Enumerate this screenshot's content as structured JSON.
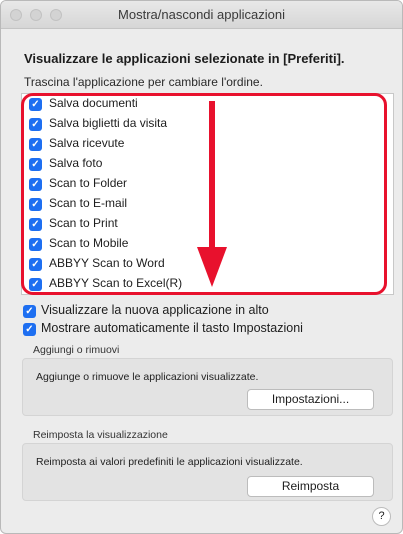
{
  "window": {
    "title": "Mostra/nascondi applicazioni"
  },
  "heading": "Visualizzare le applicazioni selezionate in [Preferiti].",
  "instruction": "Trascina l'applicazione per cambiare l'ordine.",
  "apps": [
    {
      "label": "Salva documenti",
      "checked": true
    },
    {
      "label": "Salva biglietti da visita",
      "checked": true
    },
    {
      "label": "Salva ricevute",
      "checked": true
    },
    {
      "label": "Salva foto",
      "checked": true
    },
    {
      "label": "Scan to Folder",
      "checked": true
    },
    {
      "label": "Scan to E-mail",
      "checked": true
    },
    {
      "label": "Scan to Print",
      "checked": true
    },
    {
      "label": "Scan to Mobile",
      "checked": true
    },
    {
      "label": "ABBYY Scan to Word",
      "checked": true
    },
    {
      "label": "ABBYY Scan to Excel(R)",
      "checked": true
    }
  ],
  "options": {
    "show_new_on_top": {
      "label": "Visualizzare la nuova applicazione in alto",
      "checked": true
    },
    "show_settings_button": {
      "label": "Mostrare automaticamente il tasto Impostazioni",
      "checked": true
    }
  },
  "add_remove": {
    "title": "Aggiungi o rimuovi",
    "description": "Aggiunge o rimuove le applicazioni visualizzate.",
    "button": "Impostazioni..."
  },
  "reset": {
    "title": "Reimposta la visualizzazione",
    "description": "Reimposta ai valori predefiniti le applicazioni visualizzate.",
    "button": "Reimposta"
  },
  "help": "?",
  "check_glyph": "✓",
  "colors": {
    "accent": "#1e6ff1",
    "annotation": "#e8112d"
  }
}
